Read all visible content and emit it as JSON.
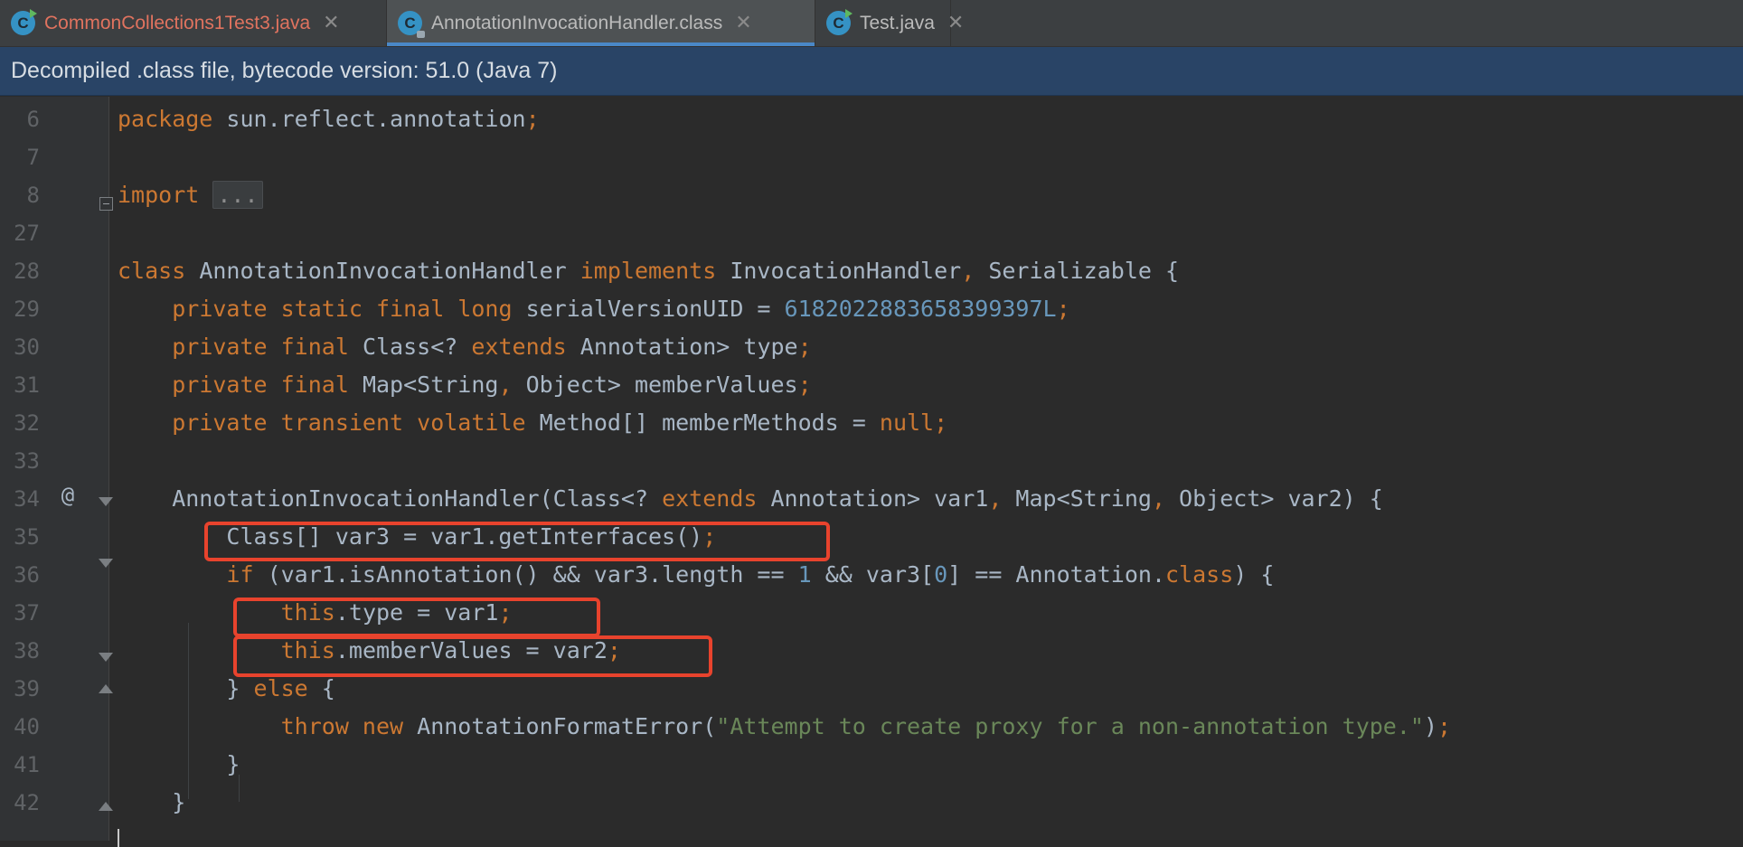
{
  "tabs": [
    {
      "label": "CommonCollections1Test3.java",
      "icon": "java-class-runnable-icon",
      "modified": true
    },
    {
      "label": "AnnotationInvocationHandler.class",
      "icon": "java-class-locked-icon",
      "active": true
    },
    {
      "label": "Test.java",
      "icon": "java-class-runnable-icon"
    }
  ],
  "tab_icon_letter": "C",
  "close_glyph": "✕",
  "banner": "Decompiled .class file, bytecode version: 51.0 (Java 7)",
  "annotation_glyph": "@",
  "lines": [
    {
      "n": "6",
      "tokens": [
        [
          "kw",
          "package "
        ],
        [
          "",
          "sun.reflect.annotation"
        ],
        [
          "kw",
          ";"
        ]
      ]
    },
    {
      "n": "7",
      "tokens": []
    },
    {
      "n": "8",
      "tokens": [
        [
          "kw",
          "import "
        ],
        [
          "fold",
          "..."
        ]
      ]
    },
    {
      "n": "27",
      "tokens": []
    },
    {
      "n": "28",
      "tokens": [
        [
          "kw",
          "class "
        ],
        [
          "",
          "AnnotationInvocationHandler "
        ],
        [
          "kw",
          "implements "
        ],
        [
          "",
          "InvocationHandler"
        ],
        [
          "kw",
          ", "
        ],
        [
          "",
          "Serializable {"
        ]
      ]
    },
    {
      "n": "29",
      "tokens": [
        [
          "",
          "    "
        ],
        [
          "kw",
          "private static final long "
        ],
        [
          "",
          "serialVersionUID = "
        ],
        [
          "num",
          "6182022883658399397L"
        ],
        [
          "kw",
          ";"
        ]
      ]
    },
    {
      "n": "30",
      "tokens": [
        [
          "",
          "    "
        ],
        [
          "kw",
          "private final "
        ],
        [
          "",
          "Class<? "
        ],
        [
          "kw",
          "extends "
        ],
        [
          "",
          "Annotation> type"
        ],
        [
          "kw",
          ";"
        ]
      ]
    },
    {
      "n": "31",
      "tokens": [
        [
          "",
          "    "
        ],
        [
          "kw",
          "private final "
        ],
        [
          "",
          "Map<String"
        ],
        [
          "kw",
          ", "
        ],
        [
          "",
          "Object> memberValues"
        ],
        [
          "kw",
          ";"
        ]
      ]
    },
    {
      "n": "32",
      "tokens": [
        [
          "",
          "    "
        ],
        [
          "kw",
          "private transient volatile "
        ],
        [
          "",
          "Method[] memberMethods = "
        ],
        [
          "kw",
          "null;"
        ]
      ]
    },
    {
      "n": "33",
      "tokens": []
    },
    {
      "n": "34",
      "tokens": [
        [
          "",
          "    AnnotationInvocationHandler(Class<? "
        ],
        [
          "kw",
          "extends "
        ],
        [
          "",
          "Annotation> var1"
        ],
        [
          "kw",
          ", "
        ],
        [
          "",
          "Map<String"
        ],
        [
          "kw",
          ", "
        ],
        [
          "",
          "Object> var2) {"
        ]
      ]
    },
    {
      "n": "35",
      "tokens": [
        [
          "",
          "        Class[] var3 = var1.getInterfaces()"
        ],
        [
          "kw",
          ";"
        ]
      ]
    },
    {
      "n": "36",
      "tokens": [
        [
          "",
          "        "
        ],
        [
          "kw",
          "if "
        ],
        [
          "",
          "(var1.isAnnotation() && var3.length == "
        ],
        [
          "num",
          "1"
        ],
        [
          "",
          " && var3["
        ],
        [
          "num",
          "0"
        ],
        [
          "",
          "] == Annotation."
        ],
        [
          "kw",
          "class"
        ],
        [
          "",
          ") {"
        ]
      ]
    },
    {
      "n": "37",
      "tokens": [
        [
          "",
          "            "
        ],
        [
          "kw",
          "this"
        ],
        [
          "",
          ".type = var1"
        ],
        [
          "kw",
          ";"
        ]
      ]
    },
    {
      "n": "38",
      "tokens": [
        [
          "",
          "            "
        ],
        [
          "kw",
          "this"
        ],
        [
          "",
          ".memberValues = var2"
        ],
        [
          "kw",
          ";"
        ]
      ]
    },
    {
      "n": "39",
      "tokens": [
        [
          "",
          "        } "
        ],
        [
          "kw",
          "else "
        ],
        [
          "",
          "{"
        ]
      ]
    },
    {
      "n": "40",
      "tokens": [
        [
          "",
          "            "
        ],
        [
          "kw",
          "throw new "
        ],
        [
          "",
          "AnnotationFormatError("
        ],
        [
          "str",
          "\"Attempt to create proxy for a non-annotation type.\""
        ],
        [
          "",
          ")"
        ],
        [
          "kw",
          ";"
        ]
      ]
    },
    {
      "n": "41",
      "tokens": [
        [
          "",
          "        }"
        ]
      ]
    },
    {
      "n": "42",
      "tokens": [
        [
          "",
          "    }"
        ]
      ]
    }
  ],
  "colors": {
    "keyword": "#cc7832",
    "number": "#6897bb",
    "string": "#6a8759",
    "text": "#a9b7c6",
    "highlight": "#e8432d",
    "active_tab": "#4a88c7"
  }
}
